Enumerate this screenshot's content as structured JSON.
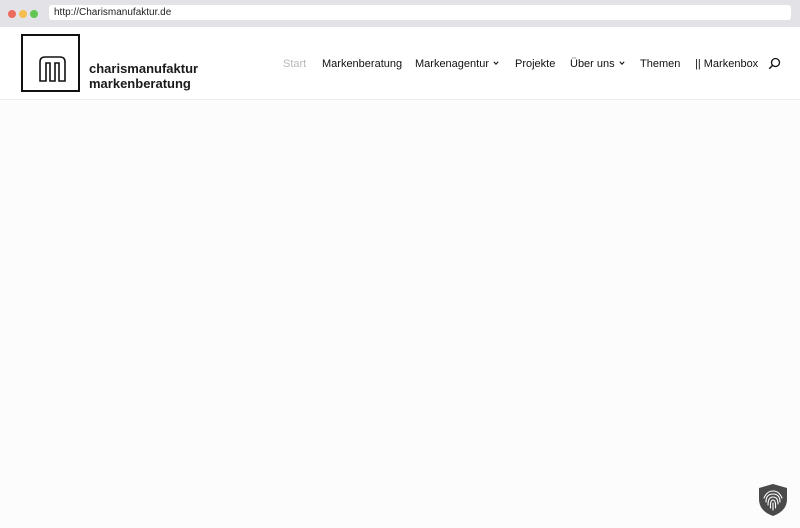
{
  "browser": {
    "url": "http://Charismanufaktur.de"
  },
  "header": {
    "logo_letter": "m",
    "brand_line1": "charismanufaktur",
    "brand_line2": "markenberatung"
  },
  "nav": {
    "items": [
      {
        "label": "Start",
        "active": true,
        "dropdown": false
      },
      {
        "label": "Markenberatung",
        "active": false,
        "dropdown": false
      },
      {
        "label": "Markenagentur",
        "active": false,
        "dropdown": true
      },
      {
        "label": "Projekte",
        "active": false,
        "dropdown": false
      },
      {
        "label": "Über uns",
        "active": false,
        "dropdown": true
      },
      {
        "label": "Themen",
        "active": false,
        "dropdown": false
      },
      {
        "label": "|| Markenbox",
        "active": false,
        "dropdown": false
      }
    ],
    "search_icon": "search-icon"
  },
  "widgets": {
    "privacy_icon": "fingerprint-shield-icon"
  },
  "colors": {
    "active_nav": "#b8b8b8",
    "text": "#111111",
    "browser_bar": "#e3e2e6"
  }
}
